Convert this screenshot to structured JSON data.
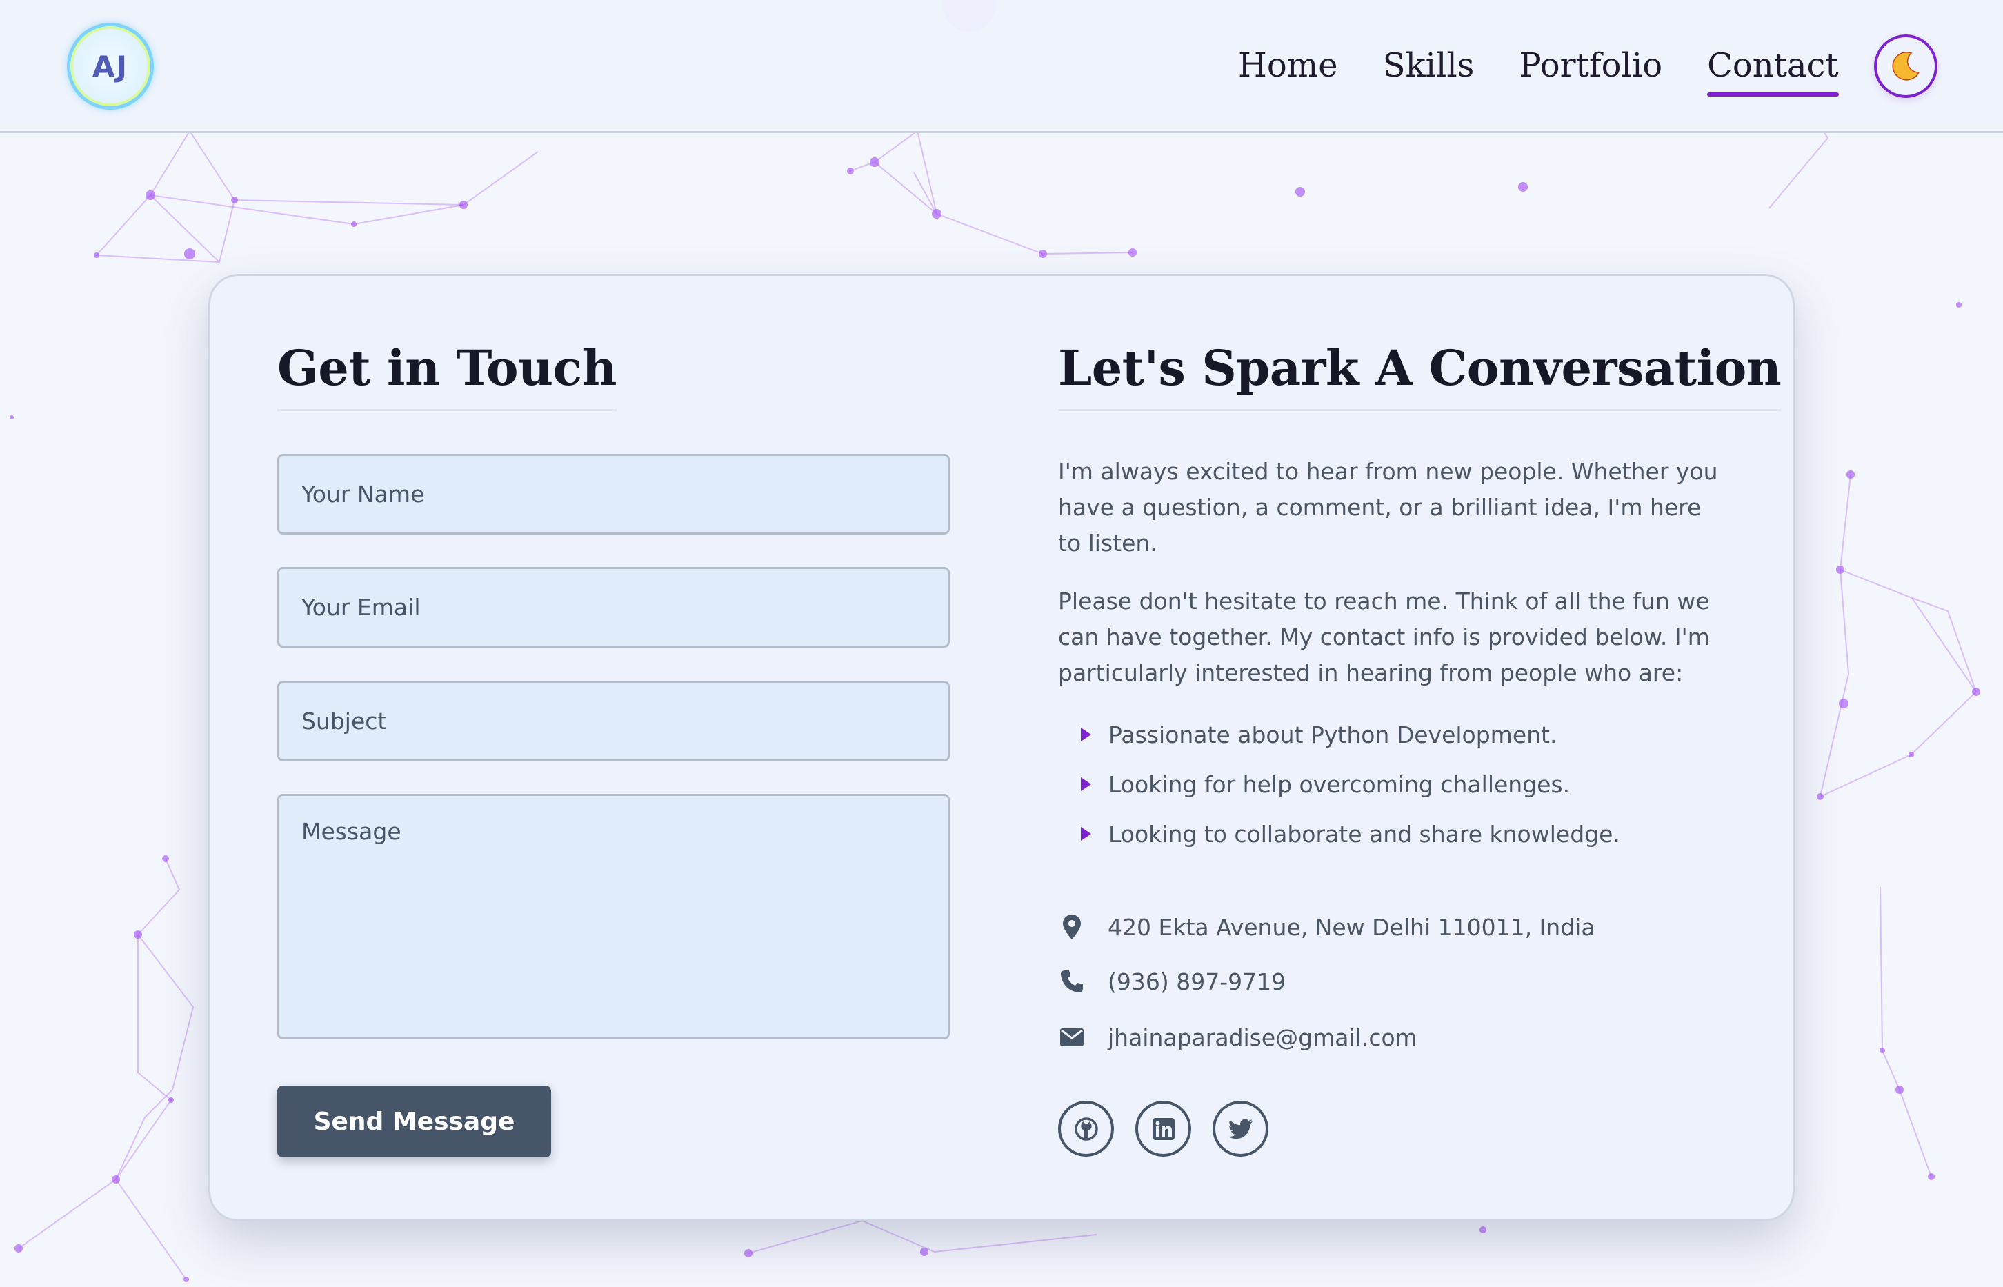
{
  "header": {
    "logo_text": "AJ",
    "nav": [
      {
        "label": "Home",
        "active": false
      },
      {
        "label": "Skills",
        "active": false
      },
      {
        "label": "Portfolio",
        "active": false
      },
      {
        "label": "Contact",
        "active": true
      }
    ],
    "theme_toggle_icon": "moon-icon"
  },
  "form": {
    "heading": "Get in Touch",
    "name_placeholder": "Your Name",
    "email_placeholder": "Your Email",
    "subject_placeholder": "Subject",
    "message_placeholder": "Message",
    "submit_label": "Send Message"
  },
  "info": {
    "heading": "Let's Spark A Conversation",
    "paragraph1": "I'm always excited to hear from new people. Whether you have a question, a comment, or a brilliant idea, I'm here to listen.",
    "paragraph2": "Please don't hesitate to reach me. Think of all the fun we can have together. My contact info is provided below. I'm particularly interested in hearing from people who are:",
    "bullets": [
      "Passionate about Python Development.",
      "Looking for help overcoming challenges.",
      "Looking to collaborate and share knowledge."
    ],
    "address": "420 Ekta Avenue, New Delhi 110011, India",
    "phone": "(936) 897-9719",
    "email": "jhainaparadise@gmail.com",
    "socials": [
      "github-icon",
      "linkedin-icon",
      "twitter-icon"
    ]
  },
  "colors": {
    "accent": "#7e22ce",
    "button": "#475569",
    "background": "#f4f6fd",
    "field": "#e1ecfb"
  }
}
